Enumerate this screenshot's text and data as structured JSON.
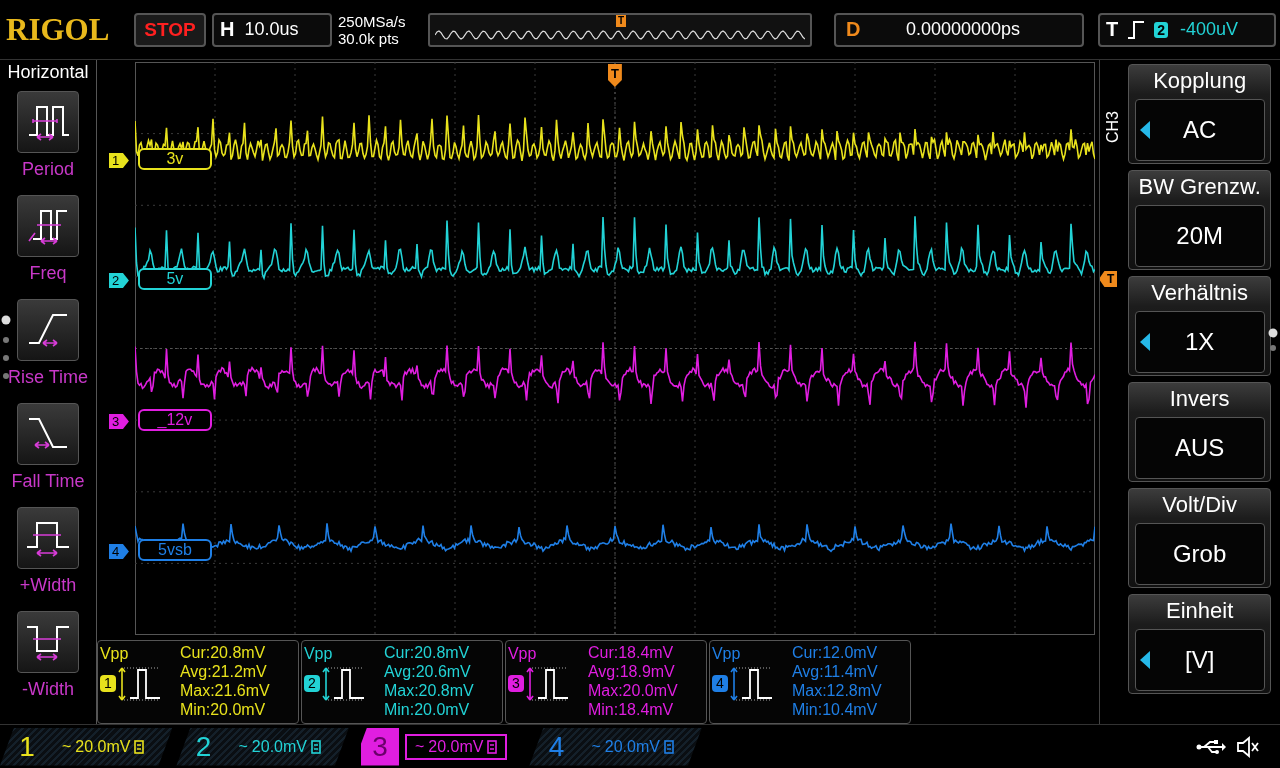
{
  "brand": "RIGOL",
  "run_state": "STOP",
  "timebase": {
    "label": "H",
    "value": "10.0us"
  },
  "sample_rate": "250MSa/s",
  "memory_depth": "30.0k pts",
  "overview": {
    "trigger_marker": "T"
  },
  "delay": {
    "label": "D",
    "value": "0.00000000ps"
  },
  "trigger": {
    "label": "T",
    "source": "2",
    "level": "-400uV"
  },
  "screen_markers": {
    "top_trigger": "T",
    "right_trigger": "T"
  },
  "measure_menu": {
    "title": "Horizontal",
    "items": [
      {
        "label": "Period",
        "kind": "period"
      },
      {
        "label": "Freq",
        "kind": "freq"
      },
      {
        "label": "Rise Time",
        "kind": "rise"
      },
      {
        "label": "Fall Time",
        "kind": "fall"
      },
      {
        "label": "+Width",
        "kind": "pwidth"
      },
      {
        "label": "-Width",
        "kind": "nwidth"
      }
    ]
  },
  "channels": [
    {
      "number": "1",
      "label": "3v",
      "color": "#e8e21c"
    },
    {
      "number": "2",
      "label": "5v",
      "color": "#22d3d6"
    },
    {
      "number": "3",
      "label": "_12v",
      "color": "#e01ee0"
    },
    {
      "number": "4",
      "label": "5vsb",
      "color": "#1f7fe6"
    }
  ],
  "measurements": [
    {
      "type": "Vpp",
      "channel": "1",
      "color": "#e8e21c",
      "lines": [
        "Cur:20.8mV",
        "Avg:21.2mV",
        "Max:21.6mV",
        "Min:20.0mV"
      ]
    },
    {
      "type": "Vpp",
      "channel": "2",
      "color": "#22d3d6",
      "lines": [
        "Cur:20.8mV",
        "Avg:20.6mV",
        "Max:20.8mV",
        "Min:20.0mV"
      ]
    },
    {
      "type": "Vpp",
      "channel": "3",
      "color": "#e01ee0",
      "lines": [
        "Cur:18.4mV",
        "Avg:18.9mV",
        "Max:20.0mV",
        "Min:18.4mV"
      ]
    },
    {
      "type": "Vpp",
      "channel": "4",
      "color": "#1f7fe6",
      "lines": [
        "Cur:12.0mV",
        "Avg:11.4mV",
        "Max:12.8mV",
        "Min:10.4mV"
      ]
    }
  ],
  "channel_menu": {
    "title": "CH3",
    "items": [
      {
        "label": "Kopplung",
        "value": "AC",
        "selectable": true
      },
      {
        "label": "BW Grenzw.",
        "value": "20M",
        "selectable": false
      },
      {
        "label": "Verhältnis",
        "value": "1X",
        "selectable": true
      },
      {
        "label": "Invers",
        "value": "AUS",
        "selectable": false
      },
      {
        "label": "Volt/Div",
        "value": "Grob",
        "selectable": false
      },
      {
        "label": "Einheit",
        "value": "[V]",
        "selectable": true
      }
    ]
  },
  "channel_bar": [
    {
      "number": "1",
      "coupling": "~",
      "scale": "20.0mV",
      "color": "#e8e21c",
      "selected": false
    },
    {
      "number": "2",
      "coupling": "~",
      "scale": "20.0mV",
      "color": "#22d3d6",
      "selected": false
    },
    {
      "number": "3",
      "coupling": "~",
      "scale": "20.0mV",
      "color": "#e01ee0",
      "selected": true
    },
    {
      "number": "4",
      "coupling": "~",
      "scale": "20.0mV",
      "color": "#1f7fe6",
      "selected": false
    }
  ]
}
